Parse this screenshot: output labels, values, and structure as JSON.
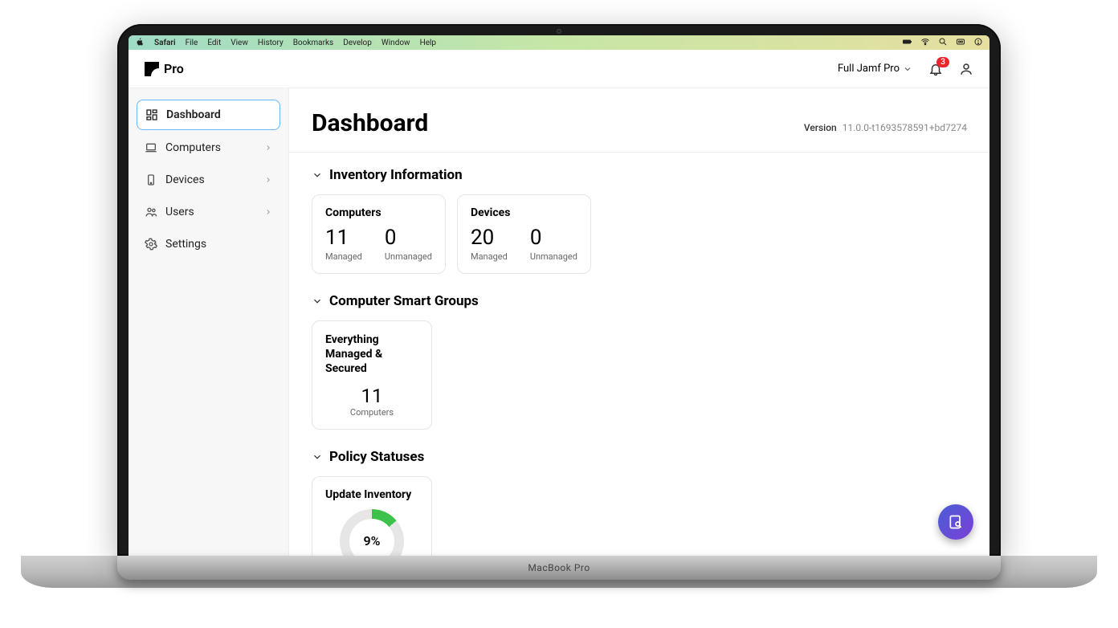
{
  "menubar": {
    "app": "Safari",
    "items": [
      "File",
      "Edit",
      "View",
      "History",
      "Bookmarks",
      "Develop",
      "Window",
      "Help"
    ]
  },
  "header": {
    "logo_text": "Pro",
    "account_label": "Full Jamf Pro",
    "notification_count": "3"
  },
  "sidebar": {
    "items": [
      {
        "label": "Dashboard"
      },
      {
        "label": "Computers"
      },
      {
        "label": "Devices"
      },
      {
        "label": "Users"
      },
      {
        "label": "Settings"
      }
    ]
  },
  "page": {
    "title": "Dashboard",
    "version_label": "Version",
    "version": "11.0.0-t1693578591+bd7274"
  },
  "inventory": {
    "title": "Inventory Information",
    "computers": {
      "title": "Computers",
      "managed": "11",
      "managed_label": "Managed",
      "unmanaged": "0",
      "unmanaged_label": "Unmanaged"
    },
    "devices": {
      "title": "Devices",
      "managed": "20",
      "managed_label": "Managed",
      "unmanaged": "0",
      "unmanaged_label": "Unmanaged"
    }
  },
  "smart_groups": {
    "title": "Computer Smart Groups",
    "card": {
      "title": "Everything Managed & Secured",
      "count": "11",
      "unit": "Computers"
    }
  },
  "policy": {
    "title": "Policy Statuses",
    "card": {
      "title": "Update Inventory",
      "percent": "9%"
    }
  },
  "laptop_label": "MacBook Pro"
}
